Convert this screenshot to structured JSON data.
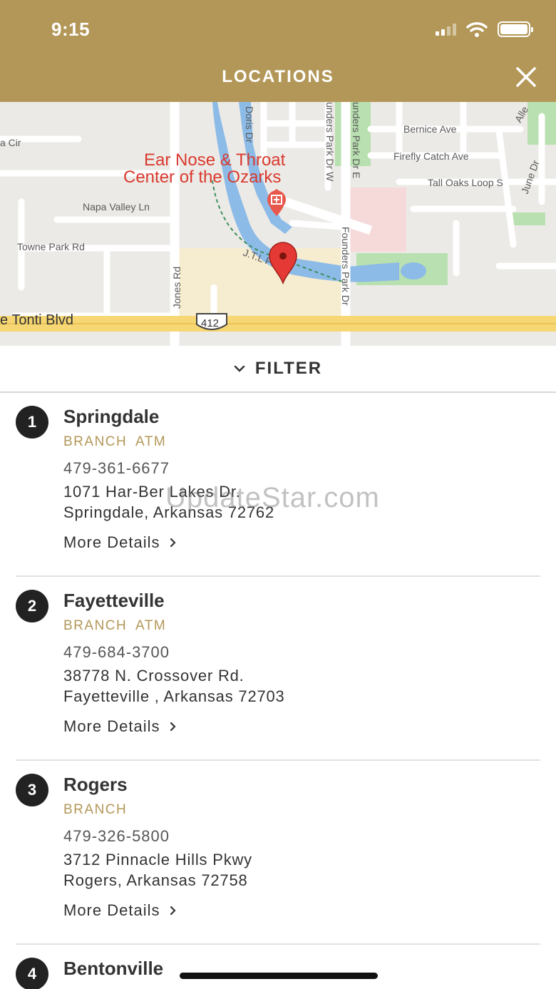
{
  "status_bar": {
    "time": "9:15"
  },
  "header": {
    "title": "LOCATIONS"
  },
  "map": {
    "poi_line1": "Ear Nose & Throat",
    "poi_line2": "Center of the Ozarks",
    "streets": {
      "a_cir": "a Cir",
      "bernice": "Bernice Ave",
      "firefly": "Firefly Catch Ave",
      "tall_oaks": "Tall Oaks Loop S",
      "june": "June Dr",
      "napa": "Napa Valley Ln",
      "towne_park": "Towne Park Rd",
      "jones": "Jones Rd",
      "doris": "Doris Dr",
      "founders_w": "unders Park Dr W",
      "founders_e": "unders Park Dr E",
      "founders": "Founders Park Dr",
      "jtl": "J.T.L Pkwy",
      "tonti": "e Tonti Blvd",
      "shield": "412",
      "allen": "Alle"
    }
  },
  "filter": {
    "label": "FILTER"
  },
  "locations": [
    {
      "number": "1",
      "name": "Springdale",
      "types": "BRANCH ATM",
      "phone": "479-361-6677",
      "address1": "1071 Har-Ber Lakes Dr.",
      "address2": "Springdale, Arkansas 72762",
      "more": "More Details"
    },
    {
      "number": "2",
      "name": "Fayetteville",
      "types": "BRANCH ATM",
      "phone": "479-684-3700",
      "address1": "38778 N. Crossover Rd.",
      "address2": "Fayetteville , Arkansas 72703",
      "more": "More Details"
    },
    {
      "number": "3",
      "name": "Rogers",
      "types": "BRANCH",
      "phone": "479-326-5800",
      "address1": "3712 Pinnacle Hills Pkwy",
      "address2": "Rogers, Arkansas 72758",
      "more": "More Details"
    },
    {
      "number": "4",
      "name": "Bentonville"
    }
  ],
  "watermark": "UpdateStar.com",
  "colors": {
    "brand": "#b39758",
    "water": "#8cbbe8",
    "park": "#b9e0b0",
    "road_major": "#f7d773",
    "pin": "#e53935",
    "poi_text": "#d93a2f"
  }
}
